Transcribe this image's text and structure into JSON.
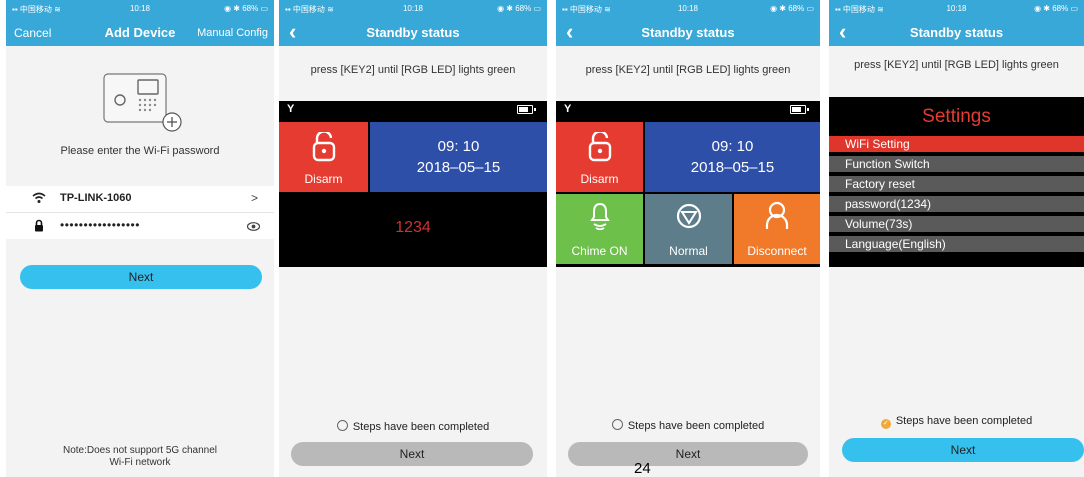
{
  "status_bar": {
    "carrier": "中国移动",
    "time": "10:18",
    "battery": "68%"
  },
  "add_device": {
    "cancel_label": "Cancel",
    "title": "Add Device",
    "manual_label": "Manual Config",
    "prompt": "Please enter the Wi-Fi password",
    "ssid": "TP-LINK-1060",
    "password_mask": "•••••••••••••••••",
    "next_label": "Next",
    "note_line1": "Note:Does not support 5G channel",
    "note_line2": "Wi-Fi network"
  },
  "standby": {
    "title": "Standby status",
    "instruction": "press [KEY2] until [RGB LED] lights green",
    "steps_done": "Steps have been completed",
    "next_label": "Next"
  },
  "panel_screen": {
    "disarm_label": "Disarm",
    "time": "09: 10",
    "date": "2018–05–15",
    "code": "1234",
    "chime_label": "Chime ON",
    "normal_label": "Normal",
    "disconnect_label": "Disconnect"
  },
  "settings_menu": {
    "title": "Settings",
    "items": [
      "WiFi Setting",
      "Function Switch",
      "Factory reset",
      "password(1234)",
      "Volume(73s)",
      "Language(English)"
    ]
  },
  "page_number": "24",
  "colors": {
    "nav_blue": "#38a8d8",
    "disarm_red": "#e53b30",
    "date_blue": "#2e4fa8",
    "chime_green": "#6dc04a",
    "normal_gray": "#5e7d8a",
    "disconnect_orange": "#f0792a",
    "next_blue": "#36c0ee",
    "next_gray": "#b9b9b9"
  }
}
